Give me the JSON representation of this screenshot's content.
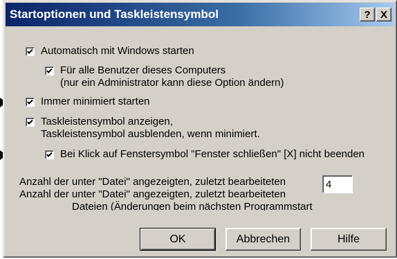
{
  "dialog": {
    "title": "Startoptionen und Taskleistensymbol",
    "help_button": "?",
    "close_button": "X"
  },
  "options": {
    "autostart": {
      "checked": true,
      "label": "Automatisch mit Windows starten"
    },
    "all_users": {
      "checked": true,
      "label_line1": "Für alle Benutzer dieses Computers",
      "label_line2": "(nur ein Administrator kann diese Option ändern)"
    },
    "start_minimized": {
      "checked": true,
      "label": "Immer minimiert starten"
    },
    "tray_icon": {
      "checked": true,
      "label_line1": "Taskleistensymbol anzeigen,",
      "label_line2": "Taskleistensymbol ausblenden, wenn minimiert."
    },
    "close_no_exit": {
      "checked": true,
      "label": "Bei Klick auf Fenstersymbol \"Fenster schließen\" [X] nicht beenden"
    }
  },
  "recent_files": {
    "label_line1": "Anzahl der unter \"Datei\" angezeigten, zuletzt bearbeiteten",
    "label_line2": "Anzahl der unter \"Datei\" angezeigten, zuletzt bearbeiteten",
    "label_line3": "Dateien (Änderungen beim nächsten Programmstart",
    "value": "4"
  },
  "buttons": {
    "ok": "OK",
    "cancel": "Abbrechen",
    "help": "Hilfe"
  },
  "colors": {
    "titlebar_start": "#0a246a",
    "titlebar_end": "#a6caf0",
    "dialog_face": "#d4d0c8"
  }
}
